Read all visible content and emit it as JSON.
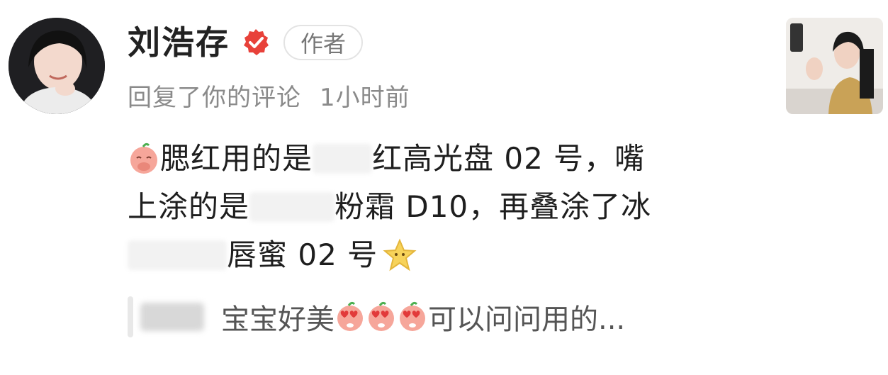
{
  "author": {
    "name": "刘浩存",
    "tag": "作者",
    "meta_action": "回复了你的评论",
    "meta_time": "1小时前"
  },
  "comment": {
    "line1_a": "腮红用的是",
    "line1_b": "红高光盘 02 号，嘴",
    "line2_a": "上涂的是",
    "line2_b": "粉霜 D10，再叠涂了冰",
    "line3_a": "唇蜜 02 号"
  },
  "reply_preview": {
    "text_a": "宝宝好美",
    "text_b": "可以问问用的..."
  },
  "icons": {
    "verified": "verified-badge-icon",
    "blush_emoji": "shy-peach-emoji-icon",
    "star_emoji": "star-emoji-icon",
    "heart_eyes_emoji": "heart-eyes-peach-emoji-icon"
  },
  "colors": {
    "verified_red": "#e8413a",
    "meta_gray": "#8a8a8a",
    "emoji_peach": "#f6a69a",
    "star_yellow": "#f7d35a"
  }
}
